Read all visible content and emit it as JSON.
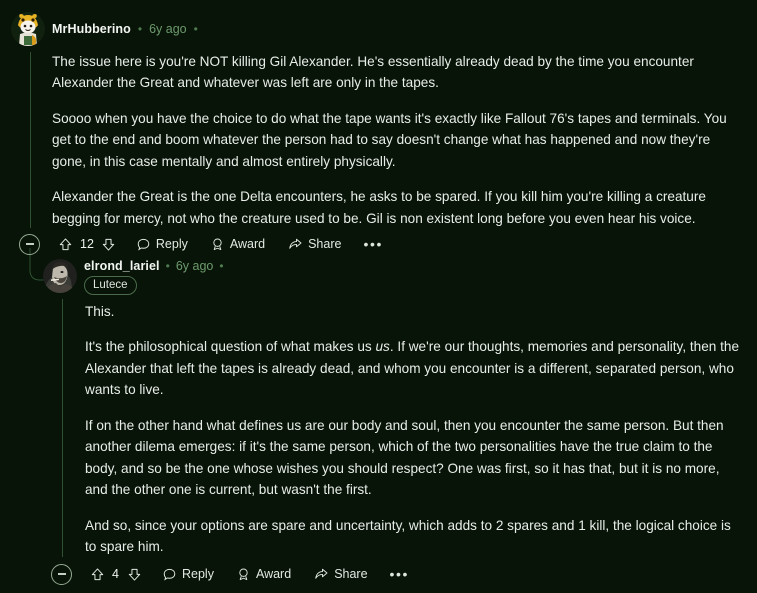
{
  "theme": {
    "background": "#071407",
    "text": "#e9ede9",
    "muted": "#6e9a6e",
    "thread_line": "#2f5130",
    "flair_border": "#4b6b4b"
  },
  "comments": [
    {
      "id": "top-comment",
      "author": "MrHubberino",
      "age": "6y ago",
      "dot": "•",
      "flair": null,
      "avatar_name": "avatar-mrhubberino",
      "paragraphs": [
        "The issue here is you're NOT killing Gil Alexander. He's essentially already dead by the time you encounter Alexander the Great and whatever was left are only in the tapes.",
        "Soooo when you have the choice to do what the tape wants it's exactly like Fallout 76's tapes and terminals. You get to the end and boom whatever the person had to say doesn't change what has happened and now they're gone, in this case mentally and almost entirely physically.",
        "Alexander the Great is the one Delta encounters, he asks to be spared. If you kill him you're killing a creature begging for mercy, not who the creature used to be. Gil is non existent long before you even hear his voice."
      ],
      "actions": {
        "collapse_label": "Collapse thread",
        "upvote_label": "Upvote",
        "score": "12",
        "downvote_label": "Downvote",
        "reply_label": "Reply",
        "award_label": "Award",
        "share_label": "Share",
        "more_label": "•••"
      }
    },
    {
      "id": "reply-comment",
      "author": "elrond_lariel",
      "age": "6y ago",
      "dot": "•",
      "flair": "Lutece",
      "avatar_name": "avatar-elrond-lariel",
      "paragraphs": [
        "This.",
        "PARA_ITALIC",
        "If on the other hand what defines us are our body and soul, then you encounter the same person. But then another dilema emerges: if it's the same person, which of the two personalities have the true claim to the body, and so be the one whose wishes you should respect? One was first, so it has that, but it is no more, and the other one is current, but wasn't the first.",
        "And so, since your options are spare and uncertainty, which adds to 2 spares and 1 kill, the logical choice is to spare him."
      ],
      "para_italic": {
        "before": "It's the philosophical question of what makes us ",
        "italic": "us",
        "after": ". If we're our thoughts, memories and personality, then the Alexander that left the tapes is already dead, and whom you encounter is a different, separated person, who wants to live."
      },
      "actions": {
        "collapse_label": "Collapse thread",
        "upvote_label": "Upvote",
        "score": "4",
        "downvote_label": "Downvote",
        "reply_label": "Reply",
        "award_label": "Award",
        "share_label": "Share",
        "more_label": "•••"
      }
    }
  ],
  "icons": {
    "upvote": "upvote-arrow-icon",
    "downvote": "downvote-arrow-icon",
    "reply": "comment-bubble-icon",
    "award": "award-medal-icon",
    "share": "share-arrow-icon",
    "more": "more-options-icon",
    "collapse": "collapse-minus-icon"
  }
}
